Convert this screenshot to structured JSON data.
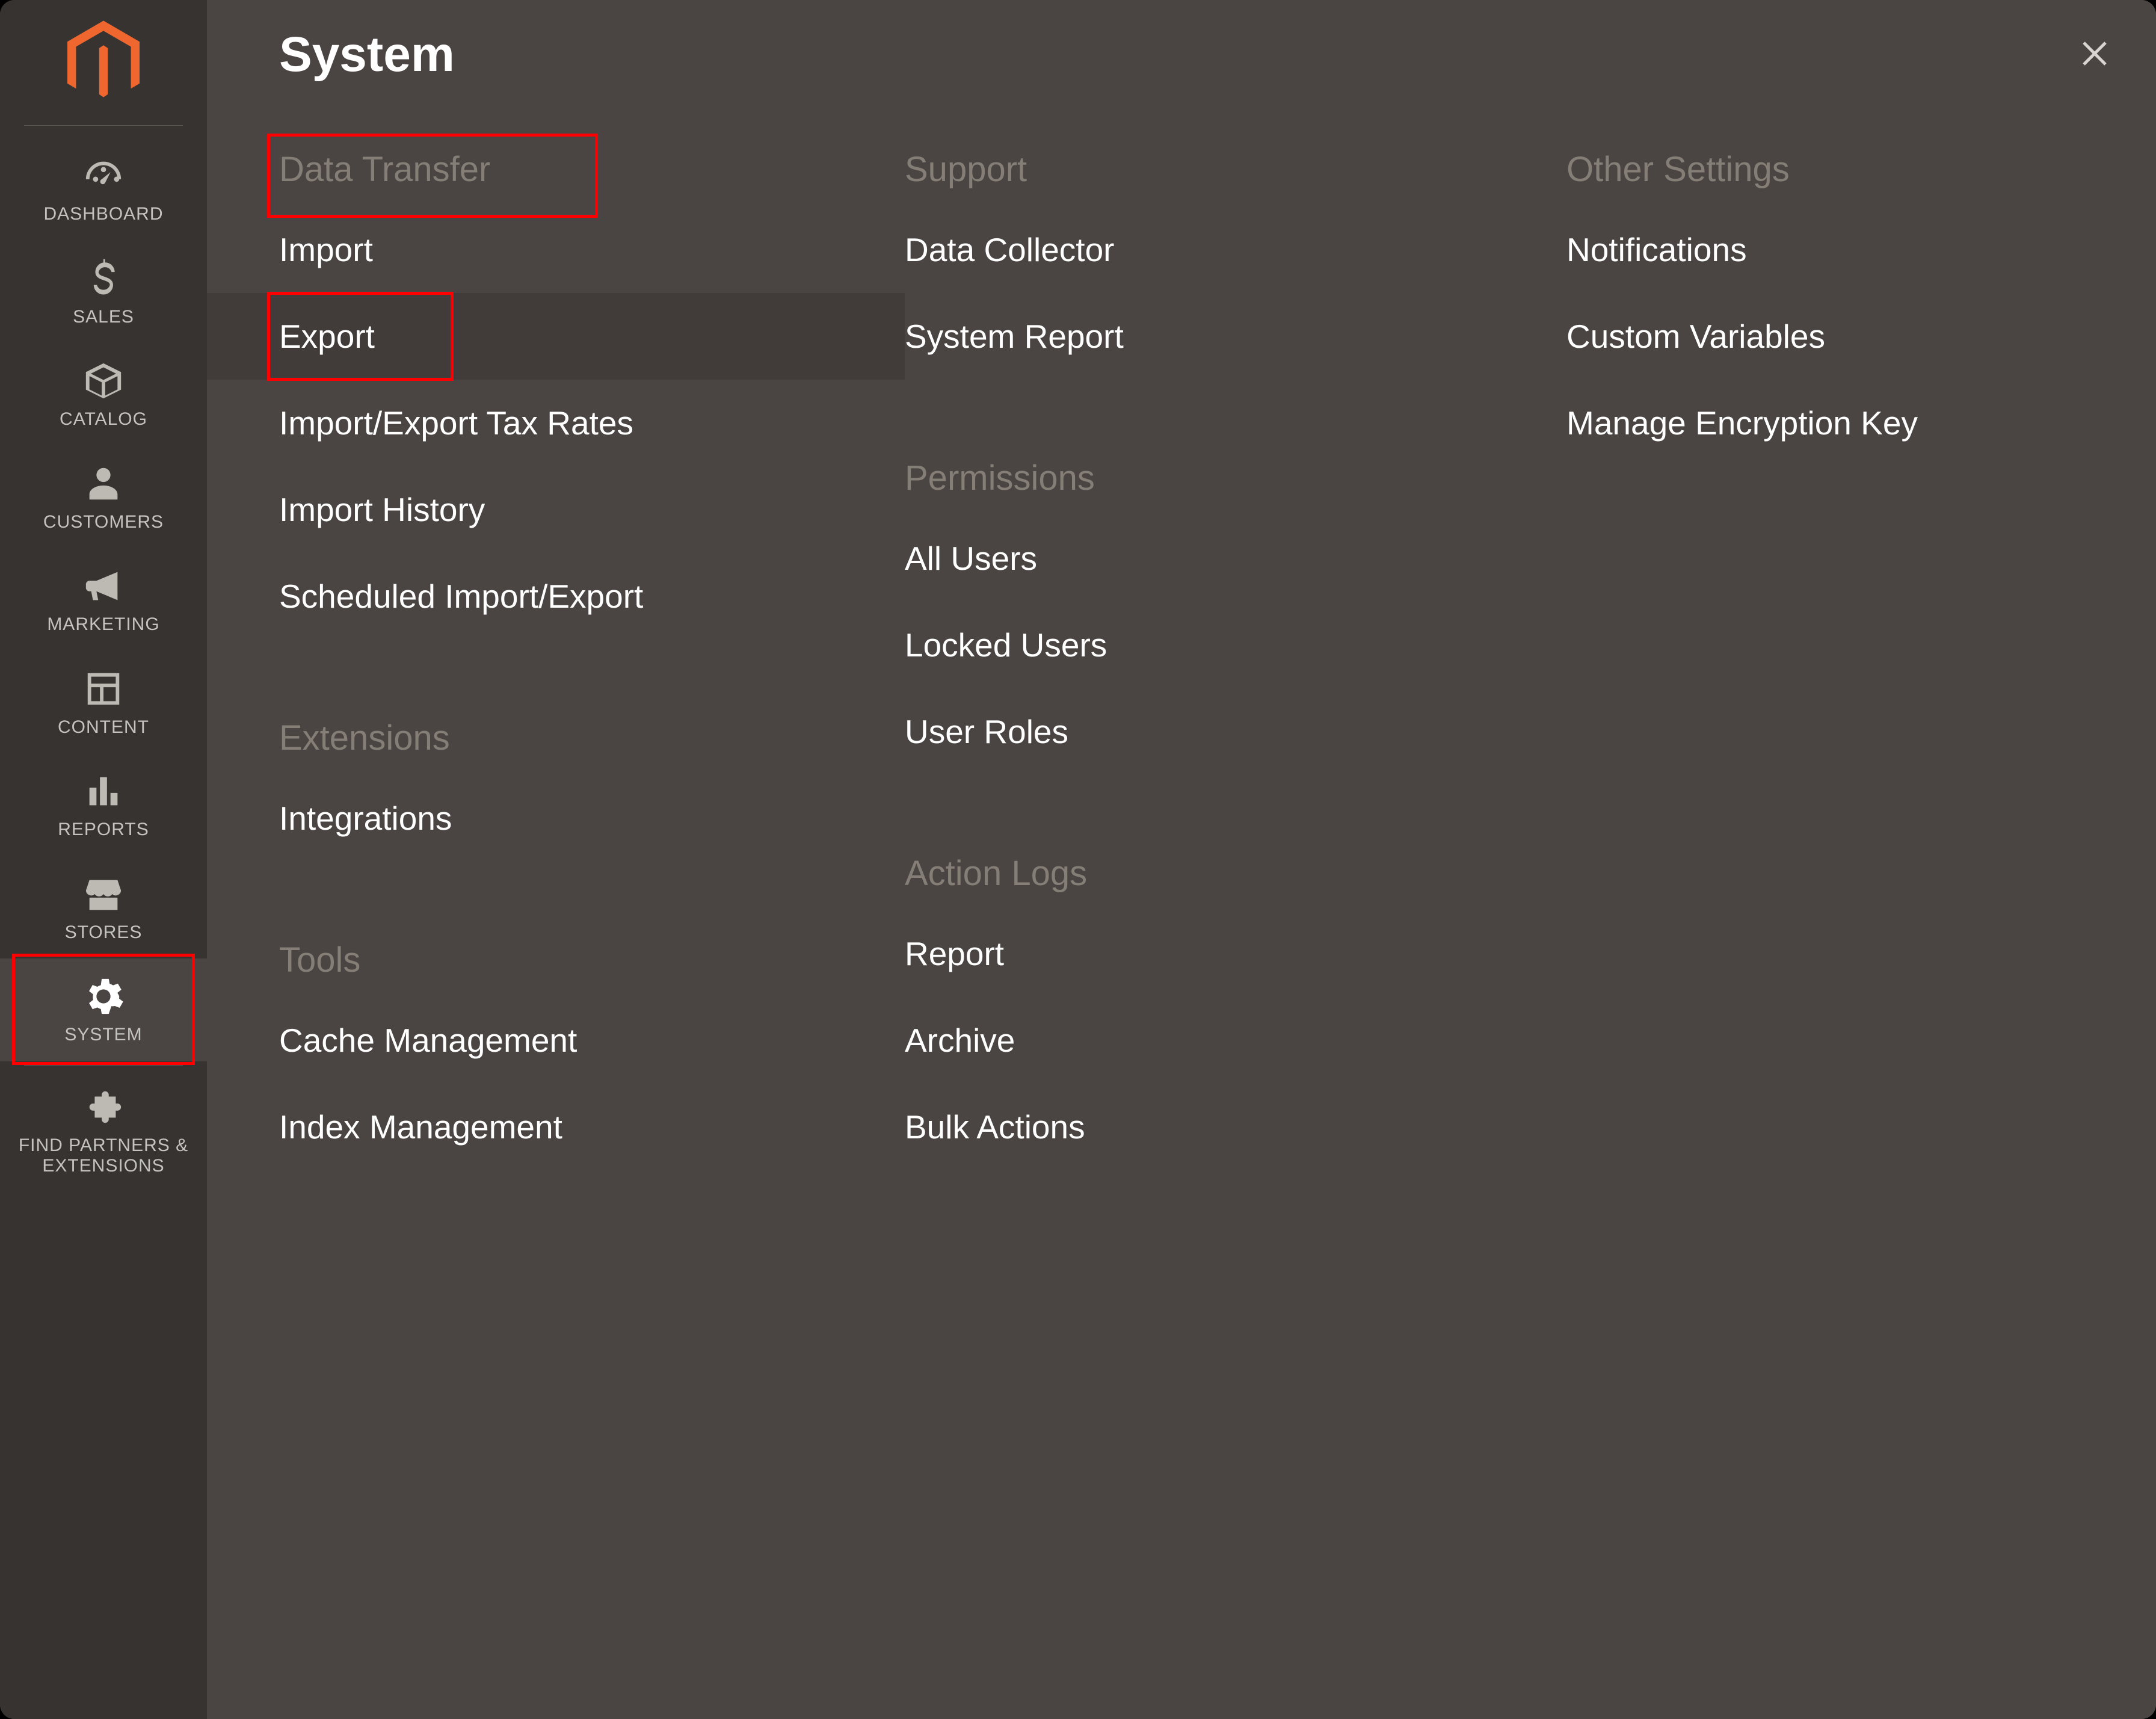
{
  "flyout": {
    "title": "System"
  },
  "sidebar": {
    "items": [
      {
        "label": "DASHBOARD"
      },
      {
        "label": "SALES"
      },
      {
        "label": "CATALOG"
      },
      {
        "label": "CUSTOMERS"
      },
      {
        "label": "MARKETING"
      },
      {
        "label": "CONTENT"
      },
      {
        "label": "REPORTS"
      },
      {
        "label": "STORES"
      },
      {
        "label": "SYSTEM"
      },
      {
        "label": "FIND PARTNERS & EXTENSIONS"
      }
    ]
  },
  "columns": {
    "data_transfer": {
      "title": "Data Transfer",
      "items": [
        "Import",
        "Export",
        "Import/Export Tax Rates",
        "Import History",
        "Scheduled Import/Export"
      ]
    },
    "extensions": {
      "title": "Extensions",
      "items": [
        "Integrations"
      ]
    },
    "tools": {
      "title": "Tools",
      "items": [
        "Cache Management",
        "Index Management"
      ]
    },
    "support": {
      "title": "Support",
      "items": [
        "Data Collector",
        "System Report"
      ]
    },
    "permissions": {
      "title": "Permissions",
      "items": [
        "All Users",
        "Locked Users",
        "User Roles"
      ]
    },
    "action_logs": {
      "title": "Action Logs",
      "items": [
        "Report",
        "Archive",
        "Bulk Actions"
      ]
    },
    "other_settings": {
      "title": "Other Settings",
      "items": [
        "Notifications",
        "Custom Variables",
        "Manage Encryption Key"
      ]
    }
  }
}
